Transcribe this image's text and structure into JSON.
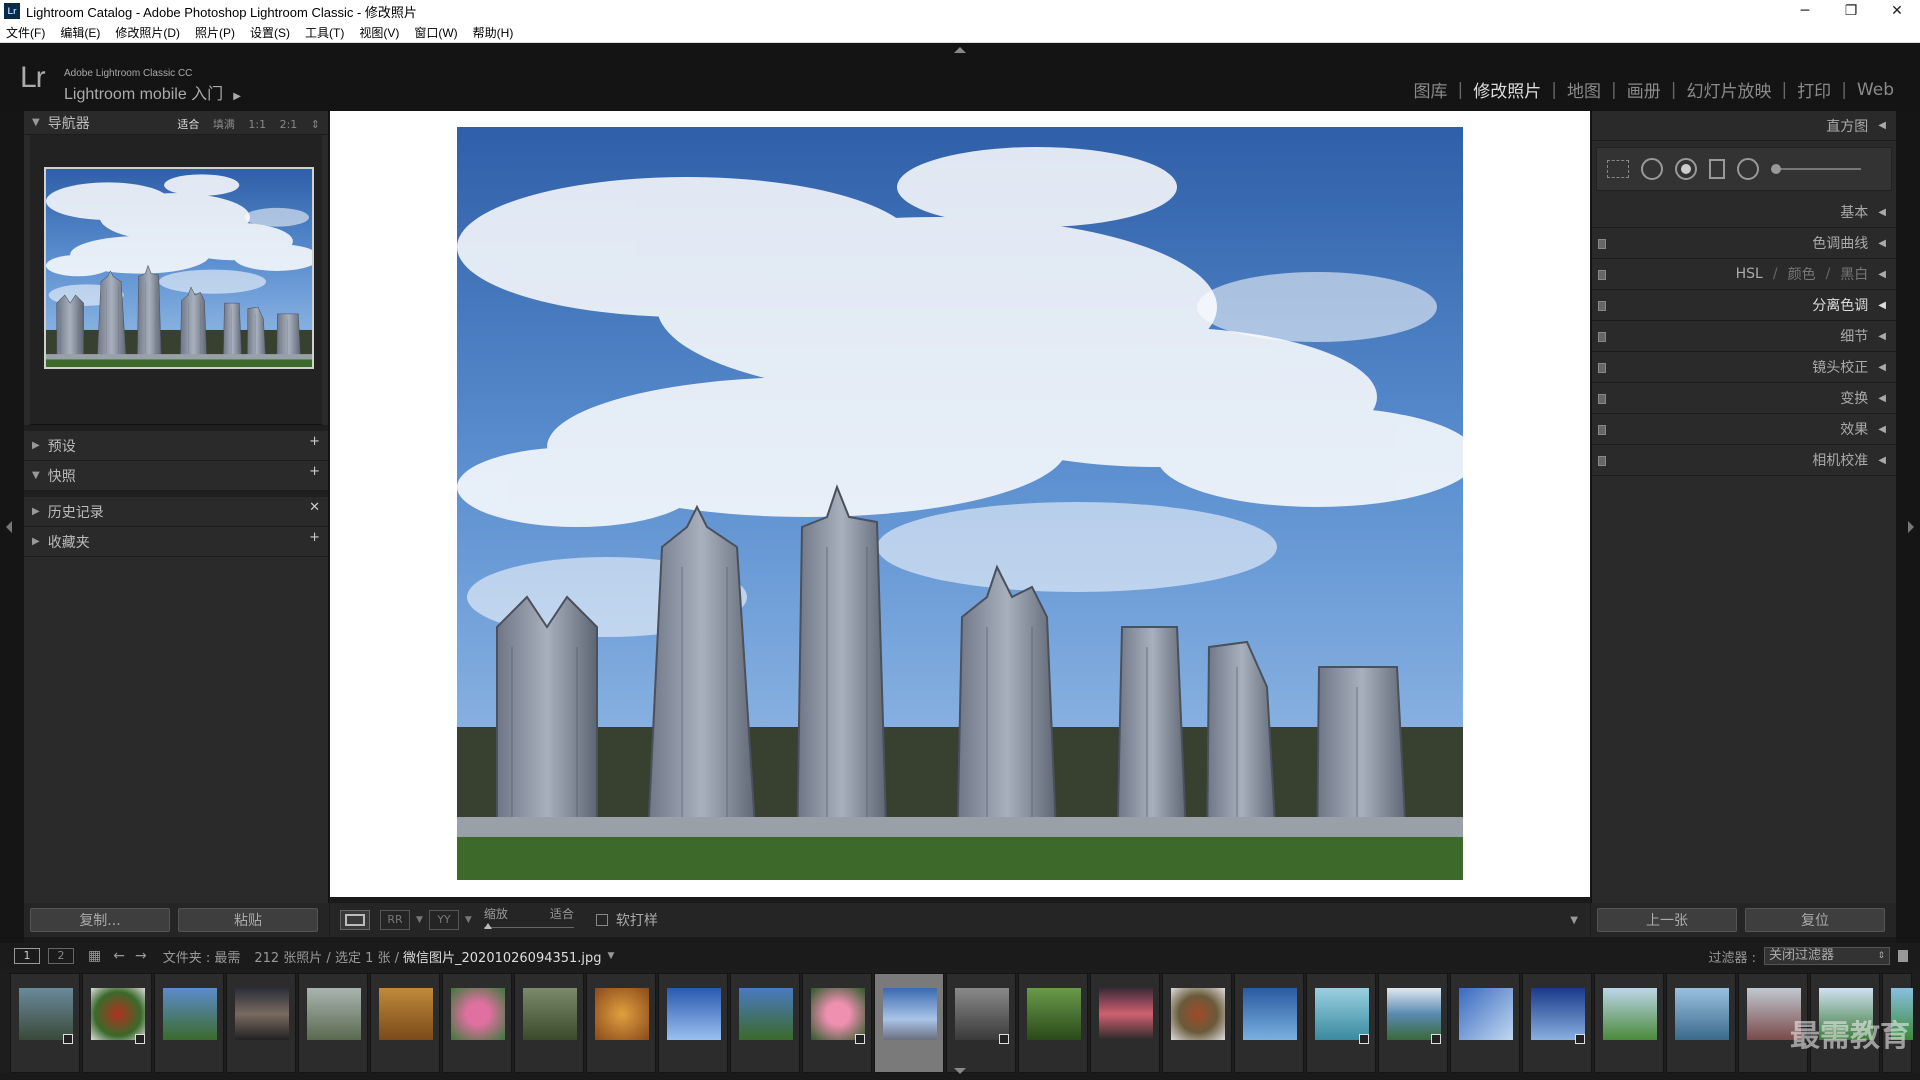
{
  "window": {
    "title": "Lightroom Catalog - Adobe Photoshop Lightroom Classic - 修改照片",
    "app_icon": "Lr",
    "minimize": "─",
    "restore": "❐",
    "close": "✕"
  },
  "menu": [
    "文件(F)",
    "编辑(E)",
    "修改照片(D)",
    "照片(P)",
    "设置(S)",
    "工具(T)",
    "视图(V)",
    "窗口(W)",
    "帮助(H)"
  ],
  "identity": {
    "logo": "Lr",
    "line1": "Adobe Lightroom Classic CC",
    "line2": "Lightroom mobile 入门",
    "arrow": "▶"
  },
  "modules": [
    "图库",
    "修改照片",
    "地图",
    "画册",
    "幻灯片放映",
    "打印",
    "Web"
  ],
  "active_module": "修改照片",
  "left_panel": {
    "navigator": {
      "title": "导航器",
      "zooms": [
        "适合",
        "填满",
        "1:1",
        "2:1"
      ],
      "active_zoom": "适合"
    },
    "sections": [
      {
        "title": "预设",
        "tri": "▶",
        "action": "+"
      },
      {
        "title": "快照",
        "tri": "▼",
        "action": "+"
      },
      {
        "title": "历史记录",
        "tri": "▶",
        "action": "✕"
      },
      {
        "title": "收藏夹",
        "tri": "▶",
        "action": "+"
      }
    ],
    "copy_button": "复制...",
    "paste_button": "粘贴"
  },
  "toolbar": {
    "zoom_label": "缩放",
    "zoom_value": "适合",
    "softproof_label": "软打样"
  },
  "right_panel": {
    "histogram": "直方图",
    "sections": [
      "基本",
      "色调曲线",
      "分离色调",
      "细节",
      "镜头校正",
      "变换",
      "效果",
      "相机校准"
    ],
    "hsl": {
      "a": "HSL",
      "b": "颜色",
      "c": "黑白"
    },
    "active_section": "分离色调",
    "prev_button": "上一张",
    "reset_button": "复位"
  },
  "filmstrip_header": {
    "page1": "1",
    "page2": "2",
    "path": "文件夹 : 最需",
    "count": "212 张照片 / 选定 1 张 /",
    "filename": "微信图片_20201026094351.jpg",
    "filter_label": "过滤器 :",
    "filter_value": "关闭过滤器"
  },
  "watermark": "最需教育",
  "colors": {
    "accent_selected": "#7a7a7a",
    "panel_bg": "#2a2a2a",
    "app_bg": "#1a1a1a"
  }
}
